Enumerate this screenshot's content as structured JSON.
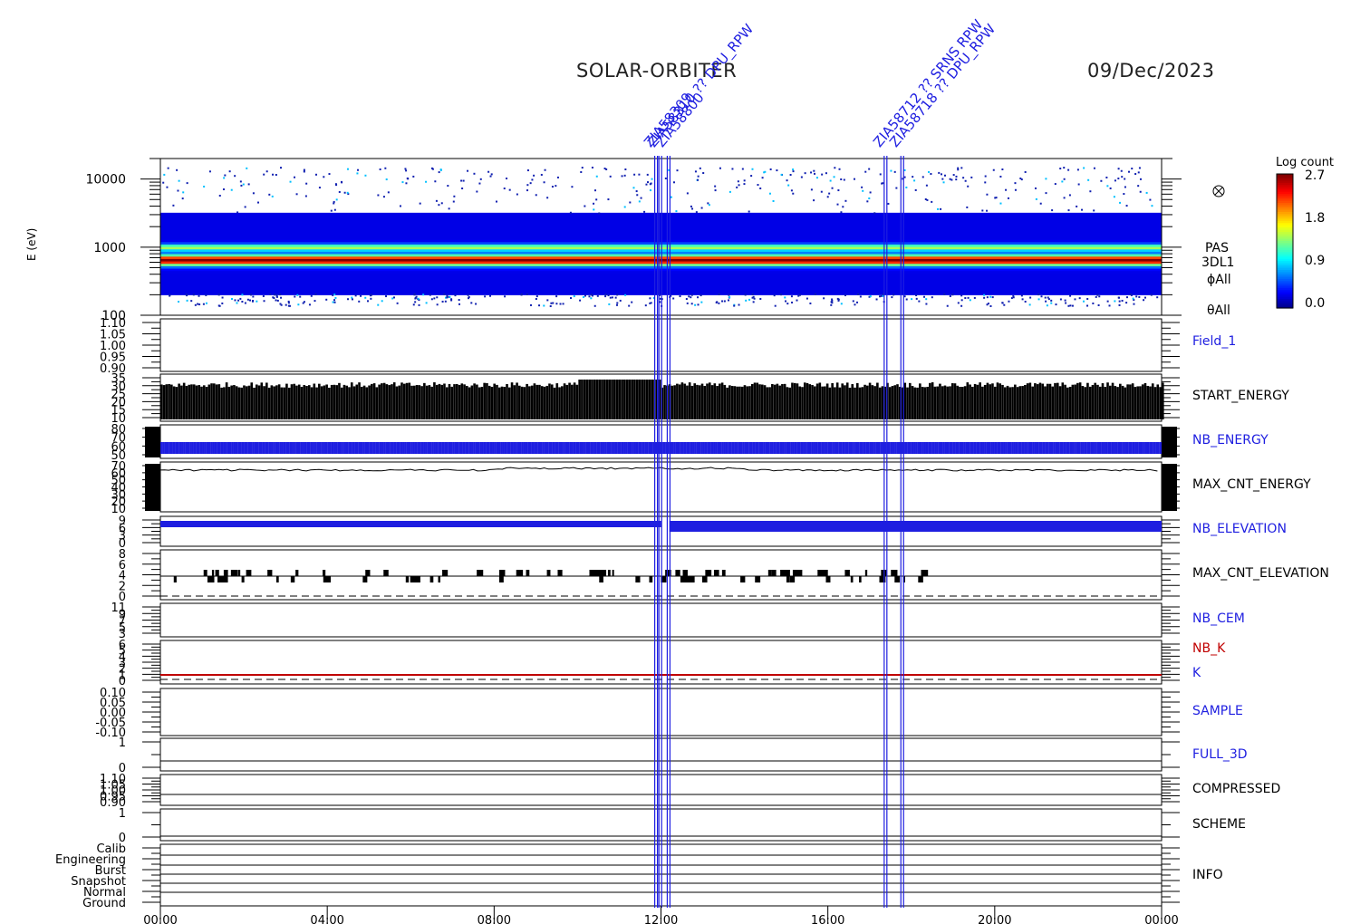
{
  "header": {
    "mission": "SOLAR-ORBITER",
    "date": "09/Dec/2023"
  },
  "colors": {
    "blue": "#1e1ee0",
    "red": "#c00000",
    "black": "#000000"
  },
  "events": [
    {
      "hour": 11.85,
      "labels": [
        "ZIA58309"
      ]
    },
    {
      "hour": 11.95,
      "labels": [
        "ZIA58310 ??",
        "DPU_RPW"
      ]
    },
    {
      "hour": 12.15,
      "labels": [
        "ZIA58800"
      ]
    },
    {
      "hour": 17.35,
      "labels": [
        "ZIA58712 ??",
        "SRNS RPW"
      ]
    },
    {
      "hour": 17.75,
      "labels": [
        "ZIA58718 ??",
        "DPU_RPW"
      ]
    }
  ],
  "panel_labels": [
    {
      "text": "Field_1",
      "color": "blue"
    },
    {
      "text": "START_ENERGY",
      "color": "black"
    },
    {
      "text": "NB_ENERGY",
      "color": "blue"
    },
    {
      "text": "MAX_CNT_ENERGY",
      "color": "black"
    },
    {
      "text": "NB_ELEVATION",
      "color": "blue"
    },
    {
      "text": "MAX_CNT_ELEVATION",
      "color": "black"
    },
    {
      "text": "NB_CEM",
      "color": "blue"
    },
    {
      "text": "NB_K",
      "color": "red"
    },
    {
      "text": "K",
      "color": "blue"
    },
    {
      "text": "SAMPLE",
      "color": "blue"
    },
    {
      "text": "FULL_3D",
      "color": "blue"
    },
    {
      "text": "COMPRESSED",
      "color": "black"
    },
    {
      "text": "SCHEME",
      "color": "black"
    },
    {
      "text": "INFO",
      "color": "black"
    }
  ],
  "spectrogram": {
    "ylabel": "E (eV)",
    "yticks": [
      "10000",
      "1000",
      "100"
    ],
    "instrument": [
      "PAS",
      "3DL1",
      "ϕAll",
      "θAll"
    ],
    "colorbar_title": "Log count",
    "colorbar_ticks": [
      "2.7",
      "1.8",
      "0.9",
      "0.0"
    ]
  },
  "chart_data": {
    "type": "heatmap",
    "x_ticks": [
      "00:00",
      "04:00",
      "08:00",
      "12:00",
      "16:00",
      "20:00",
      "00:00"
    ],
    "x_range_hours": [
      0,
      24
    ],
    "spectrogram": {
      "y_range_ev": [
        100,
        20000
      ],
      "y_scale": "log",
      "z_range": [
        0.0,
        2.7
      ],
      "peak_energy_ev": 650,
      "secondary_band_ev": 1000,
      "upper_edge_ev": 3200,
      "lower_edge_ev": 200
    },
    "panels": [
      {
        "name": "Field_1",
        "ticks": [
          "1.10",
          "1.05",
          "1.00",
          "0.95",
          "0.90"
        ]
      },
      {
        "name": "START_ENERGY",
        "ticks": [
          "35",
          "30",
          "25",
          "20",
          "15",
          "10"
        ],
        "typical_value": 29,
        "max_value": 34
      },
      {
        "name": "NB_ENERGY",
        "ticks": [
          "80",
          "70",
          "60",
          "50"
        ],
        "typical_value": 60
      },
      {
        "name": "MAX_CNT_ENERGY",
        "ticks": [
          "70",
          "60",
          "50",
          "40",
          "30",
          "20",
          "10"
        ],
        "typical_value": 63
      },
      {
        "name": "NB_ELEVATION",
        "ticks": [
          "9",
          "6",
          "3",
          "0"
        ],
        "before_12h": 9,
        "after_12h": 8
      },
      {
        "name": "MAX_CNT_ELEVATION",
        "ticks": [
          "8",
          "6",
          "4",
          "2",
          "0"
        ],
        "typical_value": 4
      },
      {
        "name": "NB_CEM",
        "ticks": [
          "11",
          "9",
          "7",
          "5",
          "3"
        ]
      },
      {
        "name": "NB_K",
        "ticks": [
          "6",
          "5",
          "4",
          "3",
          "2",
          "1",
          "0"
        ],
        "value": 1
      },
      {
        "name": "SAMPLE",
        "ticks": [
          "0.10",
          "0.05",
          "0.00",
          "-0.05",
          "-0.10"
        ]
      },
      {
        "name": "FULL_3D",
        "ticks": [
          "1",
          "0"
        ],
        "value": 0
      },
      {
        "name": "COMPRESSED",
        "ticks": [
          "1.10",
          "1.05",
          "1.00",
          "0.95",
          "0.90"
        ]
      },
      {
        "name": "SCHEME",
        "ticks": [
          "1",
          "0"
        ],
        "value": 0
      },
      {
        "name": "INFO",
        "ticks": [
          "Calib",
          "Engineering",
          "Burst",
          "Snapshot",
          "Normal",
          "Ground"
        ],
        "value": "Ground"
      }
    ]
  }
}
